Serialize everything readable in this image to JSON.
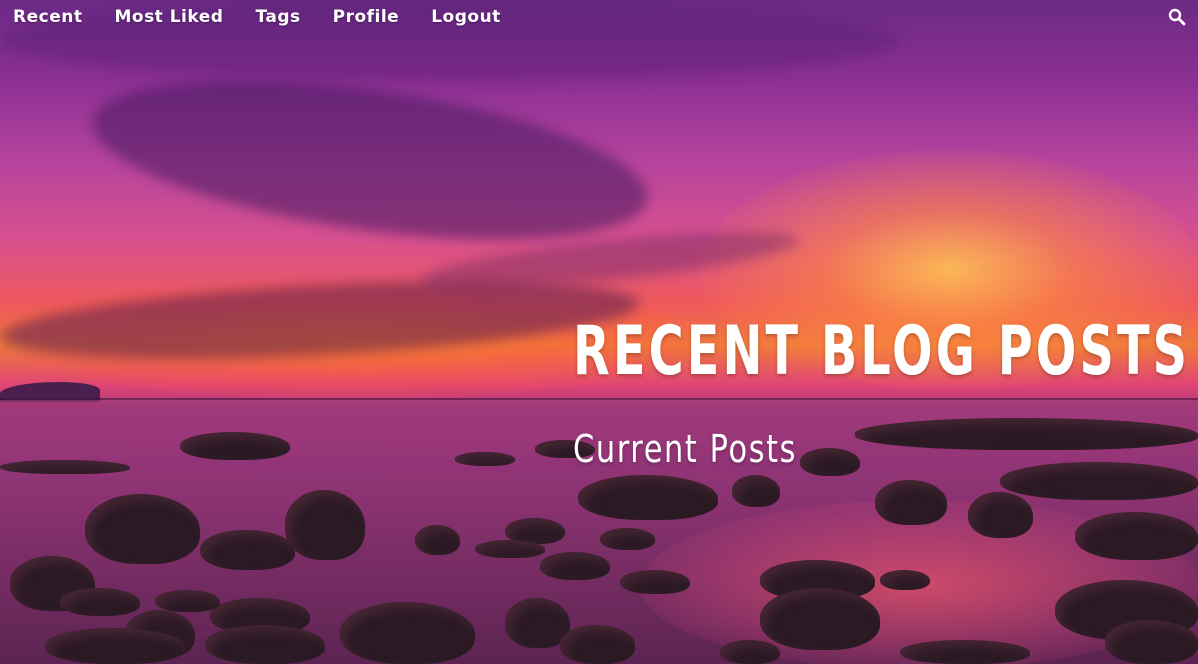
{
  "nav": {
    "links": [
      "Recent",
      "Most Liked",
      "Tags",
      "Profile",
      "Logout"
    ],
    "search_icon": "search-icon"
  },
  "hero": {
    "title": "RECENT BLOG POSTS",
    "subtitle": "Current Posts",
    "background": "sunset-over-rocky-beach"
  },
  "colors": {
    "text": "#ffffff",
    "sky_top": "#6b2a86",
    "sky_glow": "#f07a3b",
    "sea": "#a5357b"
  }
}
